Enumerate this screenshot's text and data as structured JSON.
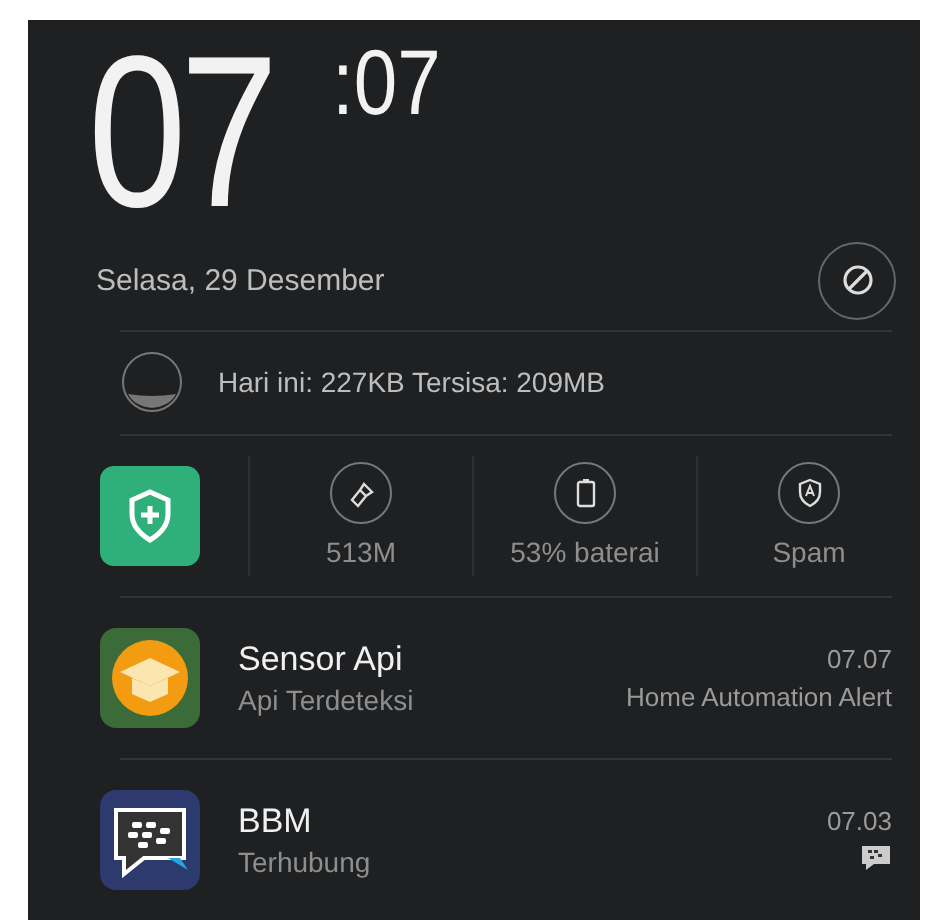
{
  "clock": {
    "hour": "07",
    "minute": ":07"
  },
  "date": "Selasa, 29 Desember",
  "data_usage": "Hari ini: 227KB Tersisa: 209MB",
  "shortcuts": [
    {
      "kind": "clean",
      "label": "513M"
    },
    {
      "kind": "battery",
      "label": "53% baterai"
    },
    {
      "kind": "spam",
      "label": "Spam"
    }
  ],
  "notifications": [
    {
      "kind": "sensor",
      "title": "Sensor Api",
      "subtitle": "Api Terdeteksi",
      "time": "07.07",
      "source": "Home Automation Alert"
    },
    {
      "kind": "bbm",
      "title": "BBM",
      "subtitle": "Terhubung",
      "time": "07.03"
    }
  ]
}
